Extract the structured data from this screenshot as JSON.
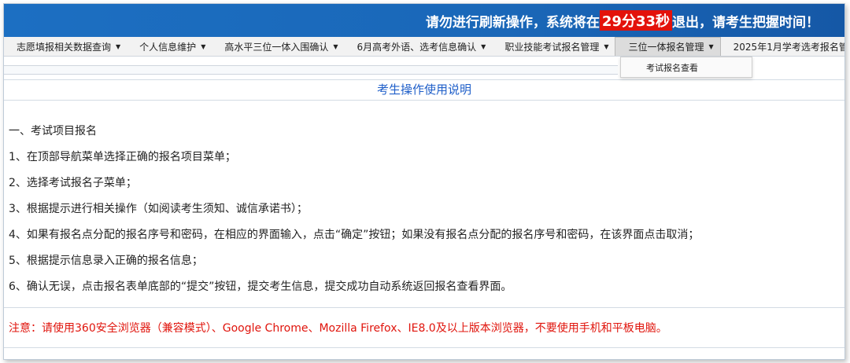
{
  "banner": {
    "prefix": "请勿进行刷新操作，系统将在",
    "timer": "29分33秒",
    "suffix": "退出，请考生把握时间！"
  },
  "nav": {
    "items": [
      {
        "label": "志愿填报相关数据查询"
      },
      {
        "label": "个人信息维护"
      },
      {
        "label": "高水平三位一体入围确认"
      },
      {
        "label": "6月高考外语、选考信息确认"
      },
      {
        "label": "职业技能考试报名管理"
      },
      {
        "label": "三位一体报名管理"
      },
      {
        "label": "2025年1月学考选考报名管理"
      }
    ],
    "dropdown_item": "考试报名查看"
  },
  "content": {
    "title": "考生操作使用说明",
    "lines": [
      "一、考试项目报名",
      "1、在顶部导航菜单选择正确的报名项目菜单；",
      "2、选择考试报名子菜单；",
      "3、根据提示进行相关操作（如阅读考生须知、诚信承诺书）；",
      "4、如果有报名点分配的报名序号和密码，在相应的界面输入，点击“确定”按钮；如果没有报名点分配的报名序号和密码，在该界面点击取消；",
      "5、根据提示信息录入正确的报名信息；",
      "6、确认无误，点击报名表单底部的“提交”按钮，提交考生信息，提交成功自动系统返回报名查看界面。"
    ],
    "note": "注意：请使用360安全浏览器（兼容模式）、Google Chrome、Mozilla Firefox、IE8.0及以上版本浏览器，不要使用手机和平板电脑。"
  },
  "colors": {
    "banner_bg": "#1a67b8",
    "timer_bg": "#e3120b",
    "title_color": "#1f5fc9",
    "note_color": "#e0140c"
  }
}
